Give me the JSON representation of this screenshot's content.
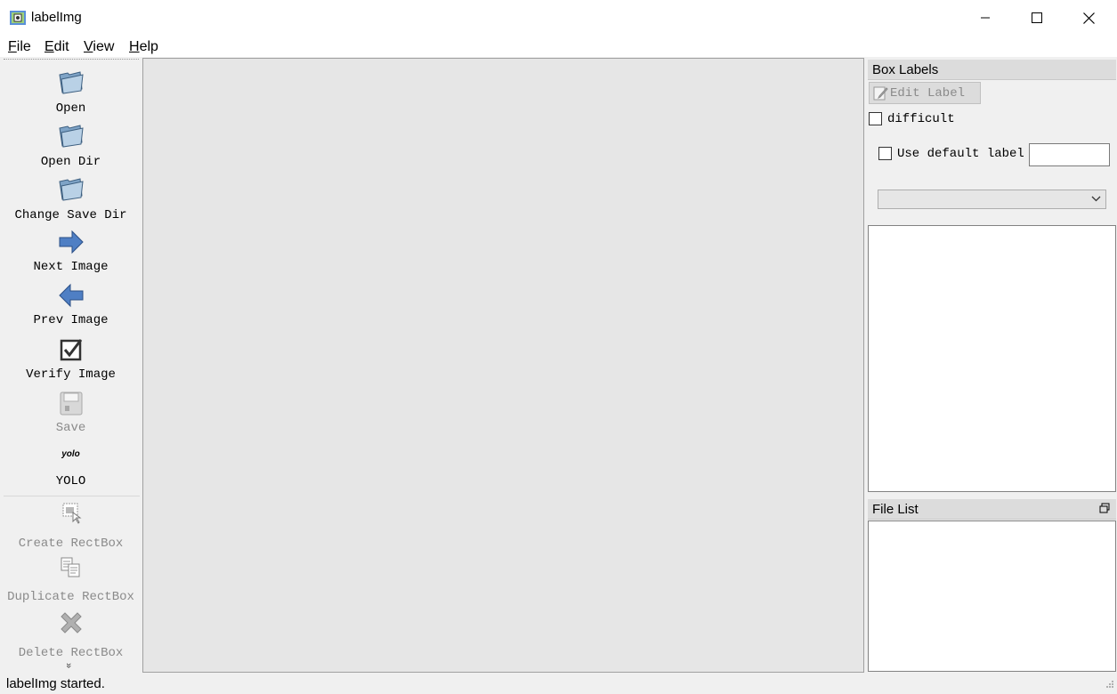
{
  "window": {
    "title": "labelImg",
    "icon": "labelimg-app-icon"
  },
  "menu": {
    "items": [
      {
        "label": "File",
        "underline": "F",
        "rest": "ile"
      },
      {
        "label": "Edit",
        "underline": "E",
        "rest": "dit"
      },
      {
        "label": "View",
        "underline": "V",
        "rest": "iew"
      },
      {
        "label": "Help",
        "underline": "H",
        "rest": "elp"
      }
    ]
  },
  "toolbar": {
    "tools": [
      {
        "label": "Open",
        "icon": "folder-open-icon",
        "enabled": true
      },
      {
        "label": "Open Dir",
        "icon": "folder-open-icon",
        "enabled": true
      },
      {
        "label": "Change Save Dir",
        "icon": "folder-open-icon",
        "enabled": true
      },
      {
        "label": "Next Image",
        "icon": "arrow-right-icon",
        "enabled": true
      },
      {
        "label": "Prev Image",
        "icon": "arrow-left-icon",
        "enabled": true
      },
      {
        "label": "Verify Image",
        "icon": "checkbox-checked-icon",
        "enabled": true
      },
      {
        "label": "Save",
        "icon": "save-icon",
        "enabled": false
      },
      {
        "label": "YOLO",
        "icon_text": "yolo",
        "icon": "yolo-format-icon",
        "enabled": true
      },
      {
        "label": "Create RectBox",
        "icon": "create-rectbox-icon",
        "enabled": false
      },
      {
        "label": "Duplicate RectBox",
        "icon": "duplicate-icon",
        "enabled": false
      },
      {
        "label": "Delete RectBox",
        "icon": "delete-icon",
        "enabled": false
      }
    ],
    "more": "»"
  },
  "box_labels": {
    "title": "Box Labels",
    "edit_label": "Edit Label",
    "difficult": "difficult",
    "use_default_label": "Use default label",
    "default_label_value": "",
    "combo_value": ""
  },
  "file_list": {
    "title": "File List"
  },
  "status": {
    "text": "labelImg started."
  }
}
